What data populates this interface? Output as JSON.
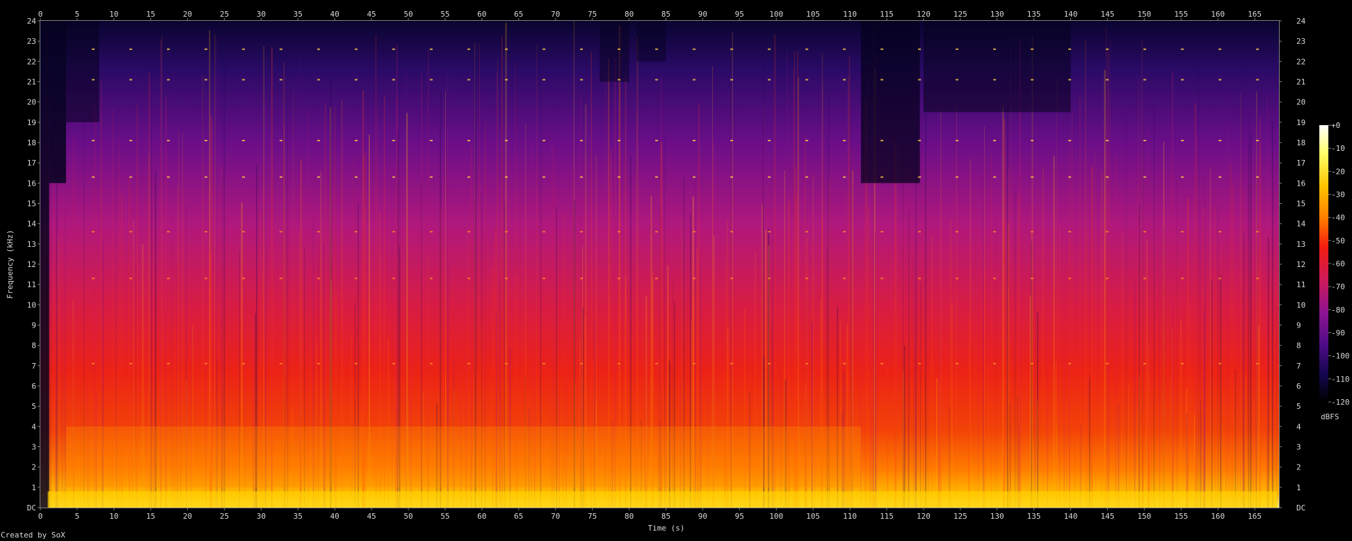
{
  "chart_data": {
    "type": "heatmap",
    "title": "",
    "xlabel": "Time (s)",
    "ylabel": "Frequency (kHz)",
    "xlim": [
      0,
      168.3
    ],
    "ylim": [
      0,
      24
    ],
    "x_ticks": [
      0,
      5,
      10,
      15,
      20,
      25,
      30,
      35,
      40,
      45,
      50,
      55,
      60,
      65,
      70,
      75,
      80,
      85,
      90,
      95,
      100,
      105,
      110,
      115,
      120,
      125,
      130,
      135,
      140,
      145,
      150,
      155,
      160,
      165
    ],
    "y_ticks": [
      "DC",
      "1",
      "2",
      "3",
      "4",
      "5",
      "6",
      "7",
      "8",
      "9",
      "10",
      "11",
      "12",
      "13",
      "14",
      "15",
      "16",
      "17",
      "18",
      "19",
      "20",
      "21",
      "22",
      "23",
      "24"
    ],
    "colorbar": {
      "label": "dBFS",
      "range": [
        -120,
        0
      ],
      "ticks": [
        "+0",
        "-10",
        "-20",
        "-30",
        "-40",
        "-50",
        "-60",
        "-70",
        "-80",
        "-90",
        "-100",
        "-110",
        "-120"
      ]
    },
    "colors": {
      "background": "#000000",
      "text": "#d8d8d8",
      "palette": [
        "#000000",
        "#0b0540",
        "#2b0a6e",
        "#5a0c8a",
        "#8c1392",
        "#bf1c78",
        "#e2253e",
        "#f21c10",
        "#ff4a00",
        "#ff8a00",
        "#ffc800",
        "#ffff5a",
        "#ffffff"
      ]
    },
    "regions": [
      {
        "t": [
          0,
          1.2
        ],
        "level": "near-silent lead-in"
      },
      {
        "t": [
          1.2,
          3.5
        ],
        "level": "high-pass region, energy below 16 kHz"
      },
      {
        "t": [
          3.5,
          111.5
        ],
        "level": "full-band loud section, dense orange below 4 kHz"
      },
      {
        "t": [
          111.5,
          119.5
        ],
        "level": "quieter, bandwidth limited to ~16 kHz"
      },
      {
        "t": [
          119.5,
          140
        ],
        "level": "loud section with gaps above 19 kHz"
      },
      {
        "t": [
          140,
          168.3
        ],
        "level": "full-band loud section"
      }
    ],
    "tonal_lines_khz": [
      7.1,
      11.3,
      13.6,
      16.3,
      18.1,
      21.1,
      22.6
    ]
  },
  "footer": {
    "credit": "Created by SoX"
  }
}
